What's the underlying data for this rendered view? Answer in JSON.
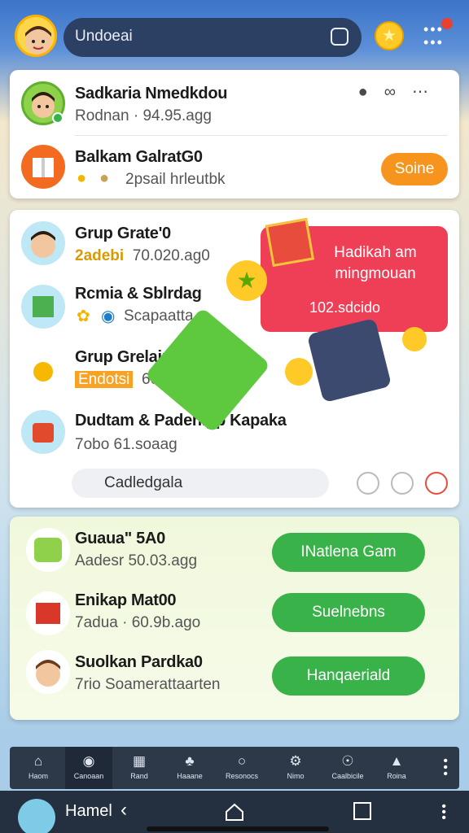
{
  "topbar": {
    "search_value": "Undoeai"
  },
  "card1": {
    "row1": {
      "title": "Sadkaria Nmedkdou",
      "sub": "Rodnan · 94.95.agg"
    },
    "row2": {
      "title": "Balkam GalratG0",
      "sub": "2psail hrleutbk",
      "button": "Soine"
    }
  },
  "card2": {
    "rows": [
      {
        "title": "Grup Grate'0",
        "sub_left": "2adebi",
        "sub_right": "70.020.ag0"
      },
      {
        "title": "Rcmia & Sblrdag",
        "sub": "Scapaatta"
      },
      {
        "title": "Grup Grelaing",
        "sub_left": "Endotsi",
        "sub_right": "60"
      },
      {
        "title": "Dudtam & Padenipp Kapaka",
        "sub": "7obo  61.soaag"
      }
    ],
    "gift": {
      "text": "Hadikah am mingmouan",
      "value": "102.sdcido"
    },
    "chat_placeholder": "Cadledgala"
  },
  "card3": {
    "rows": [
      {
        "title": "Guaua\"  5A0",
        "sub": "Aadesr 50.03.agg",
        "button": "INatlena Gam"
      },
      {
        "title": "Enikap Mat00",
        "sub": "7adua · 60.9b.ago",
        "button": "Suelnebns"
      },
      {
        "title": "Suolkan Pardka0",
        "sub": "7rio  Soamerattaarten",
        "button": "Hanqaeriald"
      }
    ]
  },
  "tabs": [
    {
      "label": "Haom",
      "icon": "home-icon"
    },
    {
      "label": "Canoaan",
      "icon": "globe-icon"
    },
    {
      "label": "Rand",
      "icon": "store-icon"
    },
    {
      "label": "Haaane",
      "icon": "tree-icon"
    },
    {
      "label": "Resonocs",
      "icon": "chat-icon"
    },
    {
      "label": "Nimo",
      "icon": "gear-icon"
    },
    {
      "label": "Caalbicile",
      "icon": "trophy-icon"
    },
    {
      "label": "Roina",
      "icon": "bell-icon"
    }
  ],
  "navbar": {
    "label": "Hamel"
  },
  "colors": {
    "accent_green": "#3ab24a",
    "accent_orange": "#f7941d",
    "gift_red": "#ee3f56"
  }
}
